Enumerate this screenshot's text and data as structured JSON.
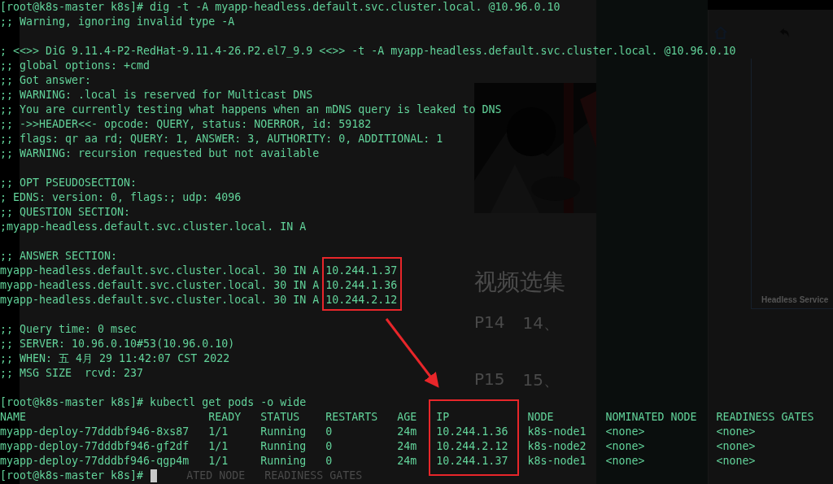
{
  "background_page": {
    "section_title": "视频选集",
    "episodes": [
      {
        "number": "P14",
        "title": "14、"
      },
      {
        "number": "P15",
        "title": "15、"
      }
    ],
    "diagram_caption": "Headless Service"
  },
  "terminal": {
    "blocks": [
      {
        "kind": "lines",
        "lines": [
          "[root@k8s-master k8s]# dig -t -A myapp-headless.default.svc.cluster.local. @10.96.0.10",
          ";; Warning, ignoring invalid type -A"
        ]
      },
      {
        "kind": "lines",
        "lines": [
          "; <<>> DiG 9.11.4-P2-RedHat-9.11.4-26.P2.el7_9.9 <<>> -t -A myapp-headless.default.svc.cluster.local. @10.96.0.10",
          ";; global options: +cmd",
          ";; Got answer:",
          ";; WARNING: .local is reserved for Multicast DNS",
          ";; You are currently testing what happens when an mDNS query is leaked to DNS",
          ";; ->>HEADER<<- opcode: QUERY, status: NOERROR, id: 59182",
          ";; flags: qr aa rd; QUERY: 1, ANSWER: 3, AUTHORITY: 0, ADDITIONAL: 1",
          ";; WARNING: recursion requested but not available"
        ]
      },
      {
        "kind": "lines",
        "lines": [
          ";; OPT PSEUDOSECTION:",
          "; EDNS: version: 0, flags:; udp: 4096",
          ";; QUESTION SECTION:",
          ";myapp-headless.default.svc.cluster.local. IN A"
        ]
      },
      {
        "kind": "records",
        "header": ";; ANSWER SECTION:",
        "highlighted": true,
        "records": [
          {
            "record": "myapp-headless.default.svc.cluster.local. 30 IN A",
            "ip": "10.244.1.37"
          },
          {
            "record": "myapp-headless.default.svc.cluster.local. 30 IN A",
            "ip": "10.244.1.36"
          },
          {
            "record": "myapp-headless.default.svc.cluster.local. 30 IN A",
            "ip": "10.244.2.12"
          }
        ]
      },
      {
        "kind": "lines",
        "lines": [
          ";; Query time: 0 msec",
          ";; SERVER: 10.96.0.10#53(10.96.0.10)",
          ";; WHEN: 五 4月 29 11:42:07 CST 2022",
          ";; MSG SIZE  rcvd: 237"
        ]
      },
      {
        "kind": "table",
        "command": "[root@k8s-master k8s]# kubectl get pods -o wide",
        "columns": [
          {
            "label": "NAME",
            "highlighted": false
          },
          {
            "label": "READY",
            "highlighted": false
          },
          {
            "label": "STATUS",
            "highlighted": false
          },
          {
            "label": "RESTARTS",
            "highlighted": false
          },
          {
            "label": "AGE",
            "highlighted": false
          },
          {
            "label": "IP",
            "highlighted": true
          },
          {
            "label": "NODE",
            "highlighted": false
          },
          {
            "label": "NOMINATED NODE",
            "highlighted": false
          },
          {
            "label": "READINESS GATES",
            "highlighted": false
          }
        ],
        "rows": [
          [
            "myapp-deploy-77dddbf946-8xs87",
            "1/1",
            "Running",
            "0",
            "24m",
            "10.244.1.36",
            "k8s-node1",
            "<none>",
            "<none>"
          ],
          [
            "myapp-deploy-77dddbf946-gf2df",
            "1/1",
            "Running",
            "0",
            "24m",
            "10.244.2.12",
            "k8s-node2",
            "<none>",
            "<none>"
          ],
          [
            "myapp-deploy-77dddbf946-qgp4m",
            "1/1",
            "Running",
            "0",
            "24m",
            "10.244.1.37",
            "k8s-node1",
            "<none>",
            "<none>"
          ]
        ],
        "prompt": "[root@k8s-master k8s]#",
        "cursor": true,
        "ghost_text": "ATED NODE   READINESS GATES"
      }
    ]
  }
}
